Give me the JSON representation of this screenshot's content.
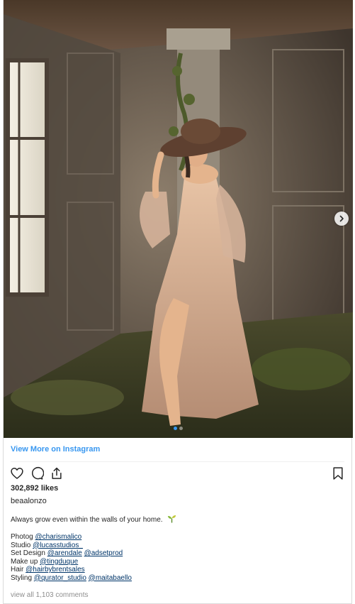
{
  "post": {
    "view_more": "View More on Instagram",
    "likes": "302,892 likes",
    "username": "beaalonzo",
    "caption": "Always grow even within the walls of your home.",
    "caption_emoji": "seedling-icon",
    "credits": [
      {
        "label": "Photog",
        "handles": [
          "@charismalico"
        ]
      },
      {
        "label": "Studio",
        "handles": [
          "@lucasstudios_"
        ]
      },
      {
        "label": "Set Design",
        "handles": [
          "@arendale",
          "@adsetprod"
        ]
      },
      {
        "label": "Make up",
        "handles": [
          "@tingduque"
        ]
      },
      {
        "label": "Hair",
        "handles": [
          "@hairbybrentsales"
        ]
      },
      {
        "label": "Styling",
        "handles": [
          "@qurator_studio",
          "@maitabaello"
        ]
      }
    ],
    "comments_link": "view all 1,103 comments",
    "carousel": {
      "count": 2,
      "active": 1
    }
  },
  "icons": [
    "heart-icon",
    "comment-icon",
    "share-icon",
    "bookmark-icon",
    "chevron-right-icon"
  ],
  "colors": {
    "link": "#3897f0",
    "handle": "#003569",
    "muted": "#8e8e8e"
  }
}
